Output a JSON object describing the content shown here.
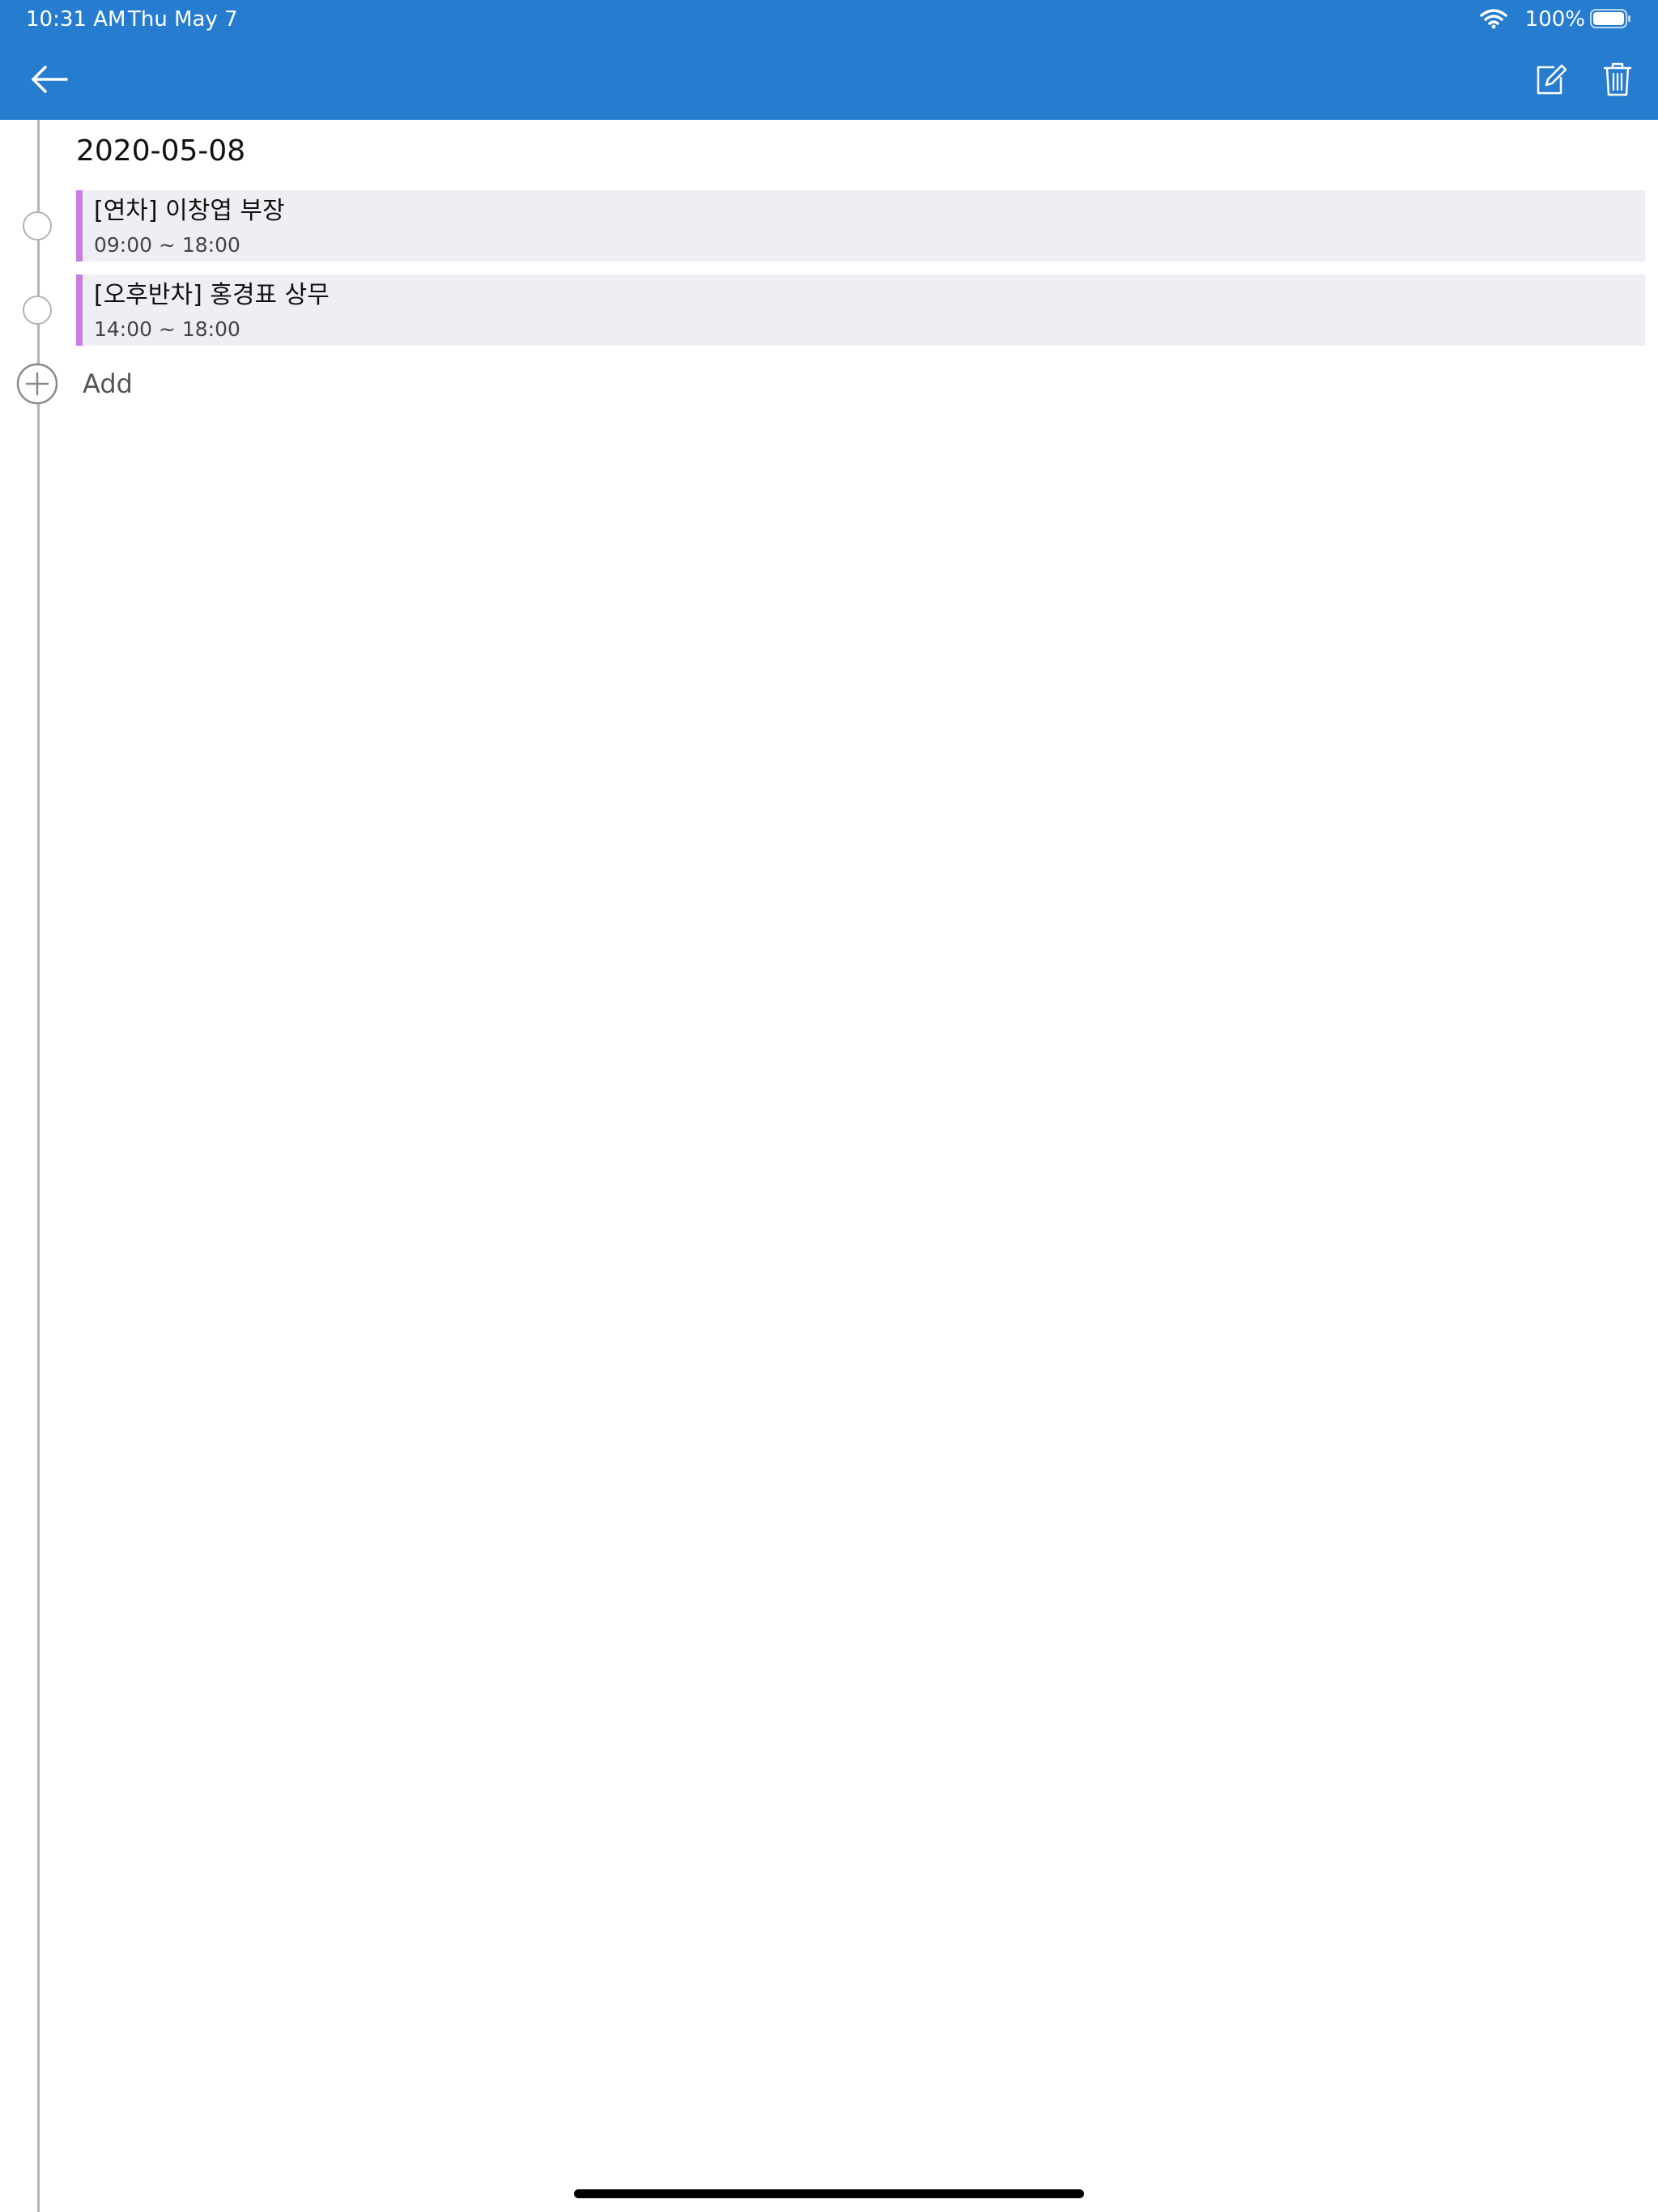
{
  "status_bar": {
    "time": "10:31 AM",
    "date": "Thu May 7",
    "battery": "100%",
    "wifi_icon": "wifi-icon",
    "battery_icon": "battery-icon"
  },
  "toolbar": {
    "back_icon": "arrow-left-icon",
    "edit_icon": "edit-icon",
    "delete_icon": "trash-icon"
  },
  "colors": {
    "appbar": "#267ccf",
    "event_accent": "#c57fe3",
    "card_background": "#efeef3"
  },
  "day": {
    "date": "2020-05-08",
    "events": [
      {
        "title": "[연차] 이창엽 부장",
        "time": "09:00 ~ 18:00"
      },
      {
        "title": "[오후반차] 홍경표 상무",
        "time": "14:00 ~ 18:00"
      }
    ]
  },
  "add": {
    "label": "Add",
    "icon": "plus-circle-icon"
  }
}
